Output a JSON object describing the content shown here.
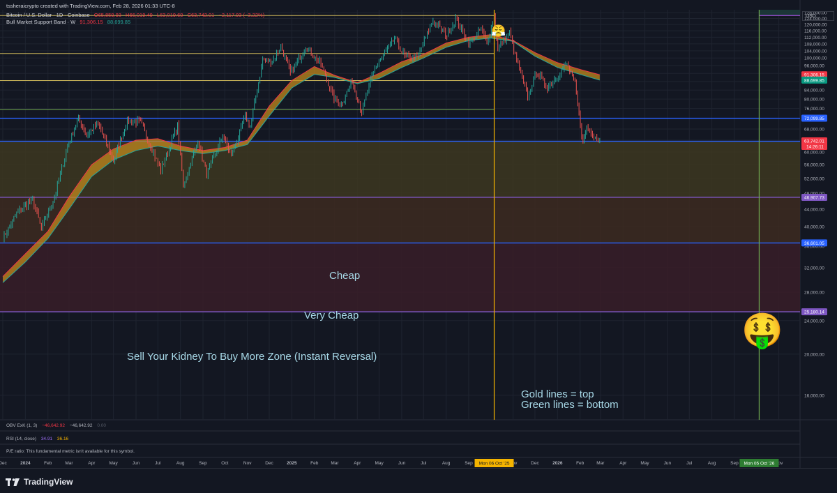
{
  "header": {
    "created_by": "tssheraicrypto created with TradingView.com, Feb 28, 2026 01:33 UTC-8",
    "symbol": "Bitcoin / U.S. Dollar · 1D · Coinbase",
    "ohlc": {
      "o": "O65,859.93",
      "h": "H66,019.49",
      "l": "L63,019.60",
      "c": "C63,742.01",
      "chg": "−2,117.93 (−3.22%)"
    },
    "indicator_name": "Bull Market Support Band · W",
    "indicator_v1": "91,306.15",
    "indicator_v2": "88,699.85",
    "currency": "USD"
  },
  "lower_panes": {
    "obv": {
      "name": "OBV ExK (1, 3)",
      "v1": "−46,642.92",
      "v2": "−46,642.92",
      "v3": "0.00"
    },
    "rsi": {
      "name": "RSI (14, close)",
      "v1": "34.91",
      "v2": "36.16"
    },
    "pe": {
      "text": "P/E ratio: This fundamental metric isn't available for this symbol."
    }
  },
  "annotations": {
    "cheap": "Cheap",
    "very_cheap": "Very Cheap",
    "kidney": "Sell Your Kidney To Buy More Zone (Instant Reversal)",
    "legend_gold": "Gold lines = top",
    "legend_green": "Green lines = bottom"
  },
  "emojis": {
    "top_face": "😤",
    "money_face": "🤑"
  },
  "branding": {
    "logo_text": "TradingView"
  },
  "colors": {
    "background": "#131722",
    "grid": "#1f2430",
    "text": "#b2b5be",
    "band_red": "#f23645",
    "band_green": "#26a69a",
    "band_fill": "#c28a1e",
    "blue_line": "#2962ff",
    "purple_line": "#7e57c2",
    "gold_line": "#c9b458",
    "green_line": "#6fa84f",
    "cursor": "#f5b400",
    "cheap_zone": "#3d3720",
    "very_cheap_zone": "#3d2a20",
    "kidney_zone": "#381d28"
  },
  "chart_data": {
    "type": "line",
    "symbol": "BTCUSD",
    "y_axis": {
      "scale": "log",
      "ylim": [
        14000,
        130000
      ],
      "ticks": [
        16000,
        20000,
        24000,
        28000,
        32000,
        36000,
        40000,
        44000,
        48000,
        52000,
        56000,
        60000,
        64000,
        68000,
        72000,
        76000,
        80000,
        84000,
        88000,
        92000,
        96000,
        100000,
        104000,
        108000,
        112000,
        116000,
        120000,
        124000,
        128000
      ],
      "tick_labels": [
        "16,000.00",
        "20,000.00",
        "24,000.00",
        "28,000.00",
        "32,000.00",
        "36,000.00",
        "40,000.00",
        "44,000.00",
        "48,000.00",
        "52,000.00",
        "56,000.00",
        "60,000.00",
        "64,000.00",
        "68,000.00",
        "72,000.00",
        "76,000.00",
        "80,000.00",
        "84,000.00",
        "88,000.00",
        "92,000.00",
        "96,000.00",
        "100,000.00",
        "104,000.00",
        "108,000.00",
        "112,000.00",
        "116,000.00",
        "120,000.00",
        "124,000.00",
        "128,000.00"
      ]
    },
    "x_axis": {
      "range": [
        "2023-12-01",
        "2026-11-10"
      ],
      "ticks": [
        {
          "date": "2023-12-01",
          "label": "Dec"
        },
        {
          "date": "2024-01-01",
          "label": "2024"
        },
        {
          "date": "2024-02-01",
          "label": "Feb"
        },
        {
          "date": "2024-03-01",
          "label": "Mar"
        },
        {
          "date": "2024-04-01",
          "label": "Apr"
        },
        {
          "date": "2024-05-01",
          "label": "May"
        },
        {
          "date": "2024-06-01",
          "label": "Jun"
        },
        {
          "date": "2024-07-01",
          "label": "Jul"
        },
        {
          "date": "2024-08-01",
          "label": "Aug"
        },
        {
          "date": "2024-09-01",
          "label": "Sep"
        },
        {
          "date": "2024-10-01",
          "label": "Oct"
        },
        {
          "date": "2024-11-01",
          "label": "Nov"
        },
        {
          "date": "2024-12-01",
          "label": "Dec"
        },
        {
          "date": "2025-01-01",
          "label": "2025"
        },
        {
          "date": "2025-02-01",
          "label": "Feb"
        },
        {
          "date": "2025-03-01",
          "label": "Mar"
        },
        {
          "date": "2025-04-01",
          "label": "Apr"
        },
        {
          "date": "2025-05-01",
          "label": "May"
        },
        {
          "date": "2025-06-01",
          "label": "Jun"
        },
        {
          "date": "2025-07-01",
          "label": "Jul"
        },
        {
          "date": "2025-08-01",
          "label": "Aug"
        },
        {
          "date": "2025-09-01",
          "label": "Sep"
        },
        {
          "date": "2025-11-01",
          "label": "Nov"
        },
        {
          "date": "2025-12-01",
          "label": "Dec"
        },
        {
          "date": "2026-01-01",
          "label": "2026"
        },
        {
          "date": "2026-02-01",
          "label": "Feb"
        },
        {
          "date": "2026-03-01",
          "label": "Mar"
        },
        {
          "date": "2026-04-01",
          "label": "Apr"
        },
        {
          "date": "2026-05-01",
          "label": "May"
        },
        {
          "date": "2026-06-01",
          "label": "Jun"
        },
        {
          "date": "2026-07-01",
          "label": "Jul"
        },
        {
          "date": "2026-08-01",
          "label": "Aug"
        },
        {
          "date": "2026-09-01",
          "label": "Sep"
        },
        {
          "date": "2026-11-01",
          "label": "Nov"
        }
      ]
    },
    "grid": true,
    "price_series": {
      "name": "Bitcoin / U.S. Dollar",
      "points": [
        [
          "2023-12-01",
          37500
        ],
        [
          "2023-12-20",
          43000
        ],
        [
          "2024-01-11",
          46500
        ],
        [
          "2024-01-23",
          39500
        ],
        [
          "2024-02-10",
          47000
        ],
        [
          "2024-02-28",
          62000
        ],
        [
          "2024-03-14",
          72000
        ],
        [
          "2024-03-25",
          66000
        ],
        [
          "2024-04-10",
          70000
        ],
        [
          "2024-05-01",
          57500
        ],
        [
          "2024-05-20",
          71000
        ],
        [
          "2024-06-07",
          70500
        ],
        [
          "2024-07-05",
          54500
        ],
        [
          "2024-07-28",
          69000
        ],
        [
          "2024-08-05",
          50000
        ],
        [
          "2024-08-25",
          64000
        ],
        [
          "2024-09-06",
          53000
        ],
        [
          "2024-09-28",
          65500
        ],
        [
          "2024-10-10",
          59000
        ],
        [
          "2024-10-29",
          72500
        ],
        [
          "2024-11-05",
          69000
        ],
        [
          "2024-11-22",
          99000
        ],
        [
          "2024-12-05",
          98000
        ],
        [
          "2024-12-17",
          107000
        ],
        [
          "2024-12-30",
          92000
        ],
        [
          "2025-01-20",
          106000
        ],
        [
          "2025-02-10",
          97000
        ],
        [
          "2025-02-28",
          80000
        ],
        [
          "2025-03-10",
          78000
        ],
        [
          "2025-03-25",
          88000
        ],
        [
          "2025-04-07",
          75000
        ],
        [
          "2025-04-25",
          95000
        ],
        [
          "2025-05-22",
          111000
        ],
        [
          "2025-06-05",
          101000
        ],
        [
          "2025-06-22",
          100000
        ],
        [
          "2025-07-14",
          122500
        ],
        [
          "2025-08-02",
          113000
        ],
        [
          "2025-08-14",
          124000
        ],
        [
          "2025-09-01",
          108000
        ],
        [
          "2025-09-18",
          117000
        ],
        [
          "2025-09-26",
          109000
        ],
        [
          "2025-10-06",
          126000
        ],
        [
          "2025-10-11",
          105000
        ],
        [
          "2025-10-27",
          115000
        ],
        [
          "2025-11-04",
          101000
        ],
        [
          "2025-11-21",
          81000
        ],
        [
          "2025-12-03",
          93000
        ],
        [
          "2025-12-18",
          85000
        ],
        [
          "2026-01-14",
          97000
        ],
        [
          "2026-01-25",
          87000
        ],
        [
          "2026-02-05",
          62500
        ],
        [
          "2026-02-10",
          69000
        ],
        [
          "2026-02-20",
          66000
        ],
        [
          "2026-02-28",
          63742
        ]
      ]
    },
    "bull_market_support_band": {
      "name": "Bull Market Support Band",
      "upper_points": [
        [
          "2023-12-01",
          30500
        ],
        [
          "2024-01-01",
          34500
        ],
        [
          "2024-02-01",
          39000
        ],
        [
          "2024-03-01",
          47000
        ],
        [
          "2024-04-01",
          56000
        ],
        [
          "2024-05-01",
          61000
        ],
        [
          "2024-06-01",
          64000
        ],
        [
          "2024-07-01",
          64500
        ],
        [
          "2024-08-01",
          62000
        ],
        [
          "2024-09-01",
          60500
        ],
        [
          "2024-10-01",
          61500
        ],
        [
          "2024-11-01",
          64000
        ],
        [
          "2024-12-01",
          77000
        ],
        [
          "2025-01-01",
          88500
        ],
        [
          "2025-02-01",
          95500
        ],
        [
          "2025-03-01",
          91000
        ],
        [
          "2025-04-01",
          87500
        ],
        [
          "2025-05-01",
          92000
        ],
        [
          "2025-06-01",
          98000
        ],
        [
          "2025-07-01",
          102000
        ],
        [
          "2025-08-01",
          108500
        ],
        [
          "2025-09-01",
          112000
        ],
        [
          "2025-10-01",
          113500
        ],
        [
          "2025-11-01",
          110000
        ],
        [
          "2025-12-01",
          103000
        ],
        [
          "2026-01-01",
          97500
        ],
        [
          "2026-02-01",
          94000
        ],
        [
          "2026-02-28",
          91306
        ]
      ],
      "lower_points": [
        [
          "2023-12-01",
          29500
        ],
        [
          "2024-01-01",
          33000
        ],
        [
          "2024-02-01",
          37500
        ],
        [
          "2024-03-01",
          44000
        ],
        [
          "2024-04-01",
          52500
        ],
        [
          "2024-05-01",
          57500
        ],
        [
          "2024-06-01",
          60500
        ],
        [
          "2024-07-01",
          62000
        ],
        [
          "2024-08-01",
          60500
        ],
        [
          "2024-09-01",
          59500
        ],
        [
          "2024-10-01",
          60500
        ],
        [
          "2024-11-01",
          62500
        ],
        [
          "2024-12-01",
          73000
        ],
        [
          "2025-01-01",
          85000
        ],
        [
          "2025-02-01",
          91500
        ],
        [
          "2025-03-01",
          90000
        ],
        [
          "2025-04-01",
          87000
        ],
        [
          "2025-05-01",
          89500
        ],
        [
          "2025-06-01",
          95000
        ],
        [
          "2025-07-01",
          100000
        ],
        [
          "2025-08-01",
          106000
        ],
        [
          "2025-09-01",
          110000
        ],
        [
          "2025-10-01",
          111500
        ],
        [
          "2025-11-01",
          109500
        ],
        [
          "2025-12-01",
          101000
        ],
        [
          "2026-01-01",
          95000
        ],
        [
          "2026-02-01",
          91500
        ],
        [
          "2026-02-28",
          88700
        ]
      ]
    },
    "horizontal_lines": [
      {
        "price": 126000,
        "color": "gold",
        "end": "2025-10-06"
      },
      {
        "price": 102500,
        "color": "gold",
        "end": "2025-10-06"
      },
      {
        "price": 88500,
        "color": "gold",
        "end": "2025-10-06"
      },
      {
        "price": 75500,
        "color": "green",
        "end": "2025-10-06"
      },
      {
        "price": 72099.85,
        "color": "blue",
        "label": "72,099.85"
      },
      {
        "price": 63621.25,
        "color": "blue",
        "label": "63,621.25"
      },
      {
        "price": 46907.73,
        "color": "purple",
        "label": "46,907.73"
      },
      {
        "price": 36601.05,
        "color": "blue",
        "label": "36,601.05"
      },
      {
        "price": 25180.14,
        "color": "purple",
        "label": "25,180.14"
      }
    ],
    "zones": [
      {
        "name": "Cheap",
        "from": 46907.73,
        "to": 63621.25
      },
      {
        "name": "Very Cheap",
        "from": 36601.05,
        "to": 46907.73
      },
      {
        "name": "Sell Your Kidney To Buy More Zone (Instant Reversal)",
        "from": 25180.14,
        "to": 36601.05
      }
    ],
    "vertical_lines": [
      {
        "date": "2025-10-06",
        "color": "cursor",
        "label": "Mon 06 Oct '25"
      },
      {
        "date": "2026-10-05",
        "color": "green",
        "label": "Mon 05 Oct '26"
      }
    ],
    "price_labels": [
      {
        "price": 91306.15,
        "label": "91,306.15",
        "color": "red"
      },
      {
        "price": 88699.85,
        "label": "88,699.85",
        "color": "green"
      },
      {
        "price": 63742.01,
        "label": "63,742.01",
        "sub": "14:26:11",
        "color": "red"
      }
    ]
  }
}
